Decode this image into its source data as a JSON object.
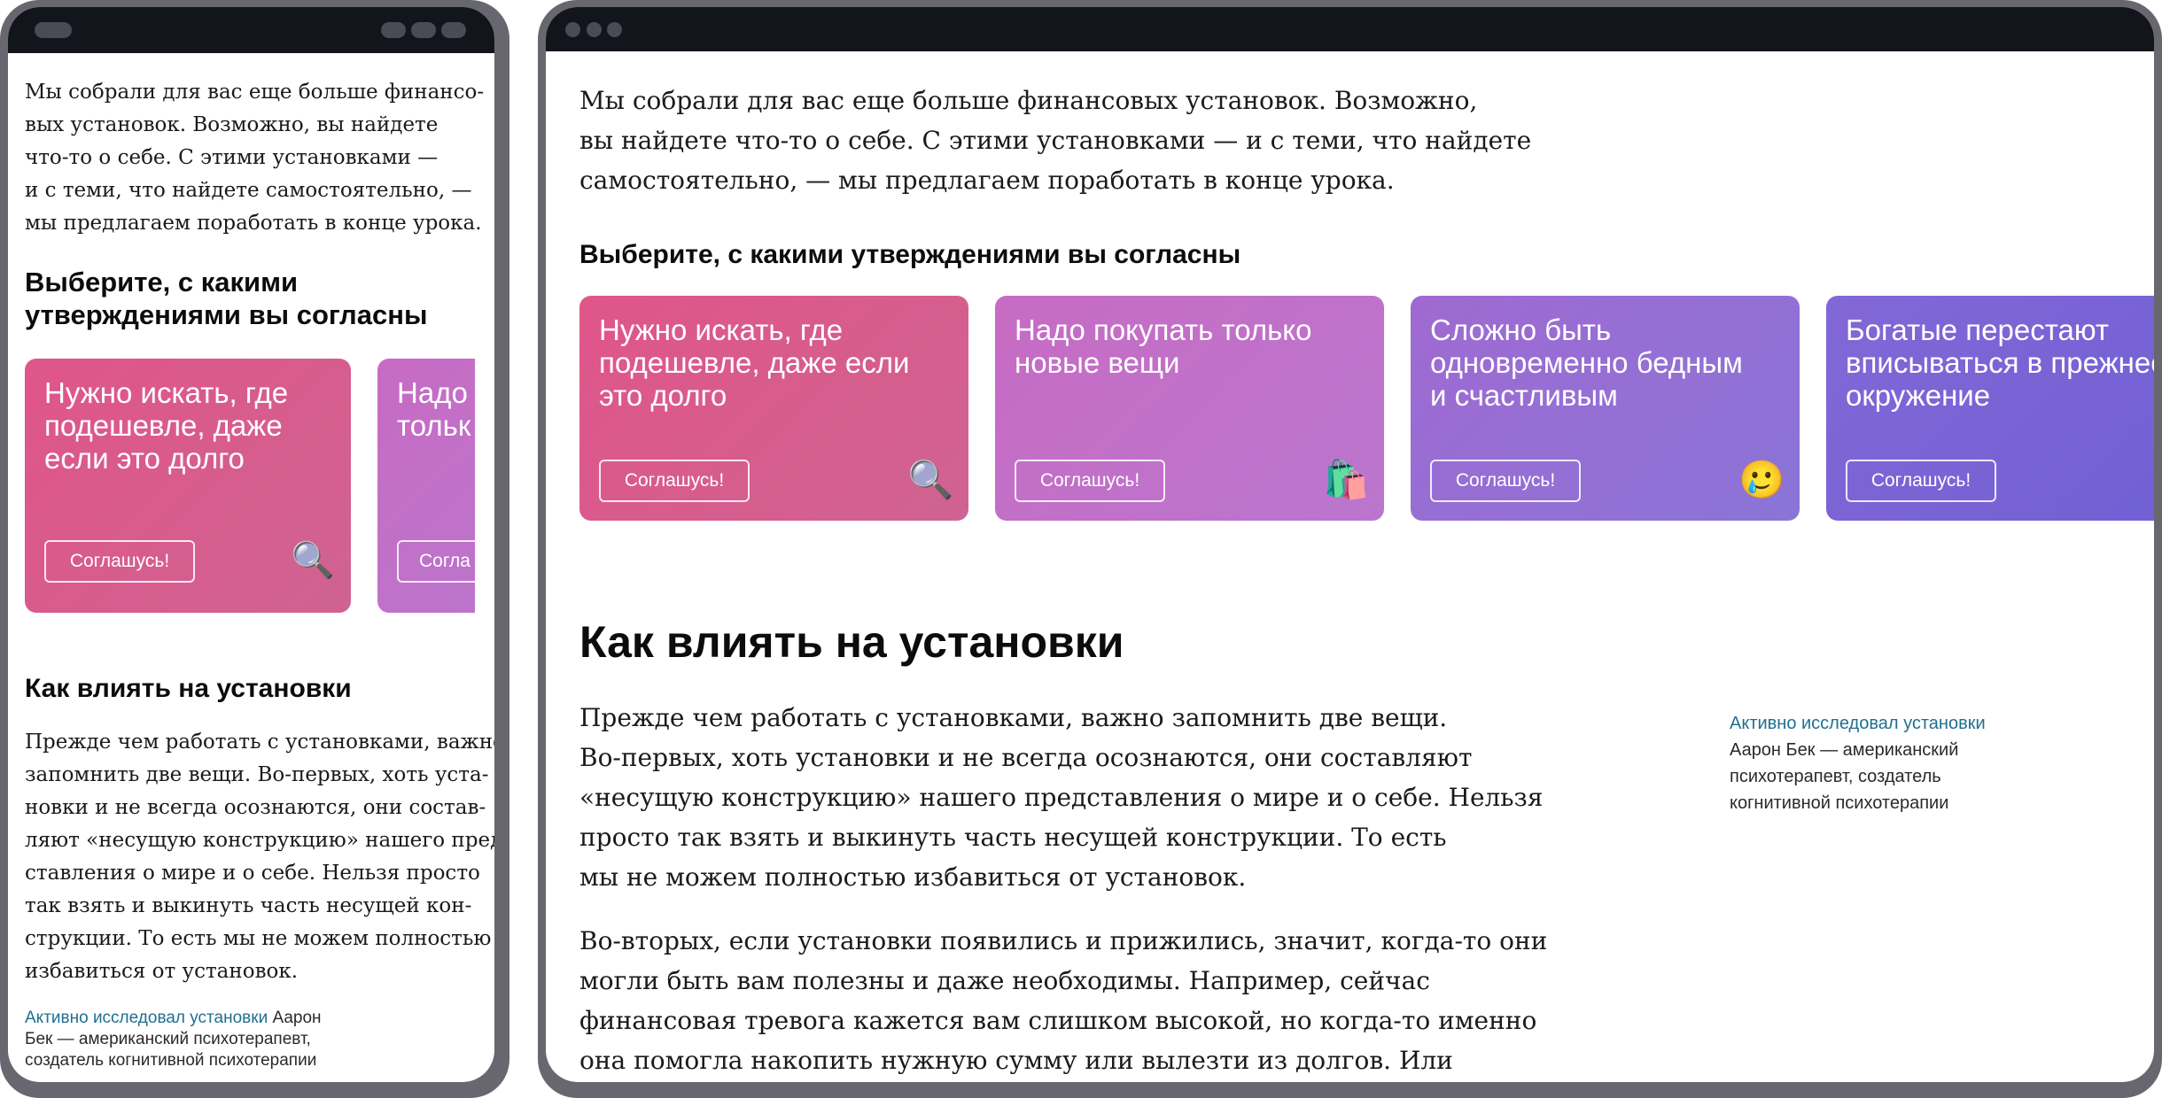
{
  "intro": "Мы собрали для вас еще больше финансовых установок. Возможно, вы найдете что-то о себе. С этими установками — и с теми, что найдете самостоятельно, — мы предлагаем поработать в конце урока.",
  "choose_heading": "Выберите, с какими утверждениями вы согласны",
  "cards": [
    {
      "text": "Нужно искать, где подешевле, даже если это долго",
      "button": "Соглашусь!",
      "emoji": "🔍",
      "emoji_name": "magnifier-icon",
      "color_start": "#e0558a",
      "color_end": "#cf6392"
    },
    {
      "text": "Надо покупать только новые вещи",
      "button": "Соглашусь!",
      "emoji": "🛍️",
      "emoji_name": "shopping-bags-icon",
      "color_start": "#c76bc4",
      "color_end": "#ba76ce"
    },
    {
      "text": "Сложно быть одновременно бедным и счастливым",
      "button": "Соглашусь!",
      "emoji": "🥲",
      "emoji_name": "smiling-tear-icon",
      "color_start": "#9f6ad2",
      "color_end": "#8a74d6"
    },
    {
      "text": "Богатые перестают вписываться в прежнее окружение",
      "button": "Соглашусь!",
      "emoji": "",
      "emoji_name": "",
      "color_start": "#8367d6",
      "color_end": "#6f60d4"
    }
  ],
  "section_heading": "Как влиять на установки",
  "paragraph1": "Прежде чем работать с установками, важно запомнить две вещи. Во-первых, хоть установки и не всегда осознаются, они составляют «несущую конструкцию» нашего представления о мире и о себе. Нельзя просто так взять и выкинуть часть несущей конструкции. То есть мы не можем полностью избавиться от установок.",
  "paragraph2": "Во-вторых, если установки появились и прижились, значит, когда-то они могли быть вам полезны и даже необходимы. Например, сейчас финансовая тревога кажется вам слишком высокой, но когда-то именно она помогла накопить нужную сумму или вылезти из долгов. Или",
  "side_note": {
    "link": "Активно исследовал установки",
    "text": "Аарон Бек — американский психотерапевт, создатель когнитивной психотерапии"
  },
  "mobile": {
    "intro_lines": [
      "Мы собрали для вас еще больше финансо-",
      "вых установок. Возможно, вы найдете",
      "что-то о себе. С этими установками —",
      "и с теми, что найдете самостоятельно, —",
      "мы предлагаем поработать в конце урока."
    ],
    "choose_lines": [
      "Выберите, с какими",
      "утверждениями вы согласны"
    ],
    "card1_lines": [
      "Нужно искать, где",
      "подешевле, даже",
      "если это долго"
    ],
    "card2_lines": [
      "Надо",
      "тольк"
    ],
    "card2_button": "Согла",
    "para_lines": [
      "Прежде чем работать с установками, важно",
      "запомнить две вещи. Во-первых, хоть уста-",
      "новки и не всегда осознаются, они состав-",
      "ляют «несущую конструкцию» нашего пред-",
      "ставления о мире и о себе. Нельзя просто",
      "так взять и выкинуть часть несущей кон-",
      "струкции. То есть мы не можем полностью",
      "избавиться от установок."
    ],
    "note_after_link": " Аарон",
    "note_lines": [
      "Бек — американский психотерапевт,",
      "создатель когнитивной психотерапии"
    ]
  },
  "desktop": {
    "intro_lines": [
      "Мы собрали для вас еще больше финансовых установок. Возможно,",
      "вы найдете что-то о себе. С этими установками — и с теми, что найдете",
      "самостоятельно, — мы предлагаем поработать в конце урока."
    ],
    "card_lines": [
      [
        "Нужно искать, где",
        "подешевле, даже если",
        "это долго"
      ],
      [
        "Надо покупать только",
        "новые вещи"
      ],
      [
        "Сложно быть",
        "одновременно бедным",
        "и счастливым"
      ],
      [
        "Богатые перестают",
        "вписываться в прежнее",
        "окружение"
      ]
    ],
    "para1_lines": [
      "Прежде чем работать с установками, важно запомнить две вещи.",
      "Во-первых, хоть установки и не всегда осознаются, они составляют",
      "«несущую конструкцию» нашего представления о мире и о себе. Нельзя",
      "просто так взять и выкинуть часть несущей конструкции. То есть",
      "мы не можем полностью избавиться от установок."
    ],
    "para2_lines": [
      "Во-вторых, если установки появились и прижились, значит, когда-то они",
      "могли быть вам полезны и даже необходимы. Например, сейчас",
      "финансовая тревога кажется вам слишком высокой, но когда-то именно",
      "она помогла накопить нужную сумму или вылезти из долгов. Или"
    ],
    "note_lines": [
      "Аарон Бек — американский",
      "психотерапевт, создатель",
      "когнитивной психотерапии"
    ]
  }
}
